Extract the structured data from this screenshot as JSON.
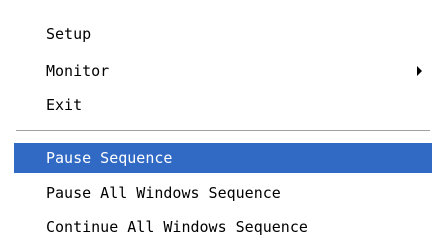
{
  "menu": {
    "items": [
      {
        "label": "Setup"
      },
      {
        "label": "Monitor",
        "has_submenu": true
      },
      {
        "label": "Exit"
      },
      {
        "label": "Pause Sequence",
        "highlighted": true
      },
      {
        "label": "Pause All Windows Sequence"
      },
      {
        "label": "Continue All Windows Sequence"
      }
    ]
  },
  "icons": {
    "submenu_arrow": "chevron-right-icon"
  },
  "colors": {
    "highlight_background": "#316ac5",
    "highlight_text": "#ffffff",
    "menu_background": "#ffffff",
    "separator": "#a0a0a0"
  }
}
